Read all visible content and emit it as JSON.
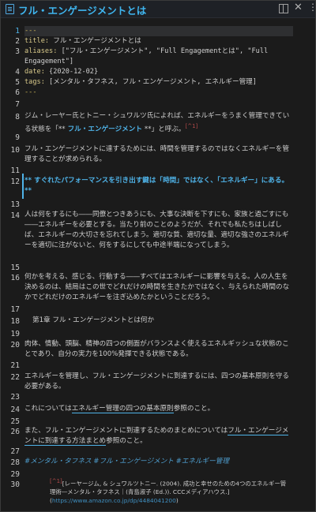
{
  "window": {
    "title": "フル・エンゲージメントとは"
  },
  "icons": [
    "document-icon",
    "preview-toggle-icon",
    "close-icon",
    "more-options-icon"
  ],
  "lines": {
    "l1": "---",
    "l2_key": "title:",
    "l2_val": " フル・エンゲージメントとは",
    "l3_key": "aliases:",
    "l3_val": " [\"フル・エンゲージメント\", \"Full Engagementとは\", \"Full Engagement\"]",
    "l4_key": "date:",
    "l4_val": " {2020-12-02}",
    "l5_key": "tags:",
    "l5_val": " [メンタル・タフネス, フル・エンゲージメント, エネルギー管理]",
    "l6": "---",
    "l8_a": "ジム・レーヤー氏とトニー・シュワルツ氏によれば、エネルギーをうまく管理できている状態を「**",
    "l8_b": " フル・エンゲージメント ",
    "l8_c": "**」と呼ぶ。",
    "l8_ref": "[^1]",
    "l10": "フル・エンゲージメントに達するためには、時間を管理するのではなくエネルギーを管理することが求められる。",
    "l12": "** すぐれたパフォーマンスを引き出す鍵は「時間」ではなく、「エネルギー」にある。**",
    "l14": "人は何をするにも――同僚とつきあうにも、大事な決断を下すにも、家族と過ごすにも――エネルギーを必要とする。当たり前のことのようだが、それでも私たちはしばしば、エネルギーの大切さを忘れてしまう。適切な質、適切な量、適切な強さのエネルギーを適切に注がないと、何をするにしても中途半端になってしまう。",
    "l16": "何かを考える、感じる、行動する――すべてはエネルギーに影響を与える。人の人生を決めるのは、結局はこの世でどれだけの時間を生きたかではなく、与えられた時間のなかでどれだけのエネルギーを注ぎ込めたかということだろう。",
    "l18": "第1章 フル・エンゲージメントとは何か",
    "l20": "肉体、情動、頭脳、精神の四つの側面がバランスよく使えるエネルギッシュな状態のことであり、自分の実力を100%発揮できる状態である。",
    "l22": "エネルギーを管理し、フル・エンゲージメントに到達するには、四つの基本原則を守る必要がある。",
    "l24_a": "これについては",
    "l24_link": "エネルギー管理の四つの基本原則",
    "l24_b": "参照のこと。",
    "l26_a": "また、フル・エンゲージメントに到達するためのまとめについては",
    "l26_link": "フル・エンゲージメントに到達する方法まとめ",
    "l26_b": "参照のこと。",
    "l28": "#メンタル・タフネス #フル・エンゲージメント #エネルギー管理",
    "l30_ref": "[^1]",
    "l30_a": "[レーヤージム, & シュワルツトニー. (2004). 成功と幸せのための4つのエネルギー管理術―メンタル・タフネス｜(青島淑子 (Ed.)). CCCメディアハウス.](",
    "l30_url": "https://www.amazon.co.jp/dp/4484041200",
    "l30_b": ")"
  },
  "line_numbers": [
    "1",
    "2",
    "3",
    "4",
    "5",
    "6",
    "7",
    "8",
    "9",
    "10",
    "11",
    "12",
    "13",
    "14",
    "15",
    "16",
    "17",
    "18",
    "19",
    "20",
    "21",
    "22",
    "23",
    "24",
    "25",
    "26",
    "27",
    "28",
    "29",
    "30"
  ],
  "colors": {
    "accent": "#4fb3e8",
    "frontmatter": "#c9b25a",
    "footnote_ref": "#b24a4a",
    "background": "#1b1b1b"
  }
}
